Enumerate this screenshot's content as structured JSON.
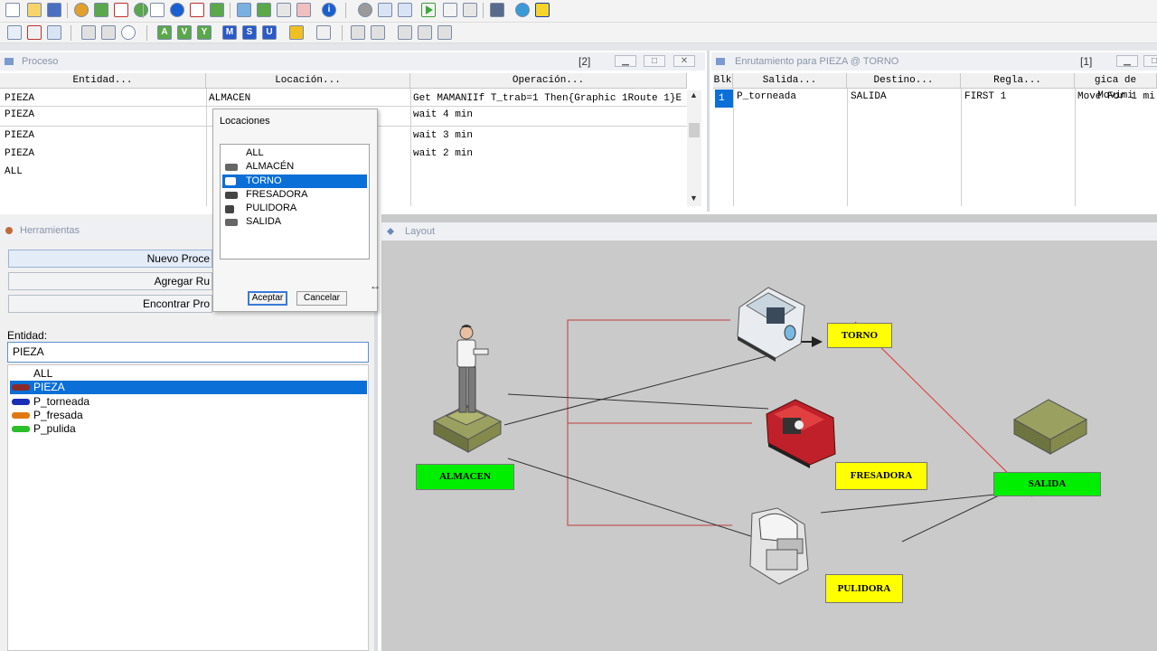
{
  "toolbar1": {
    "icons": [
      "new-icon",
      "open-icon",
      "save-icon",
      "palette-icon",
      "layers-icon",
      "route-icon",
      "person-icon",
      "rectangle-icon",
      "circle-icon",
      "arrow-icon",
      "grid-icon",
      "image-icon",
      "text-icon",
      "info-icon",
      "settings-icon",
      "window-icon",
      "export-icon",
      "play-icon",
      "step-icon",
      "stop-icon",
      "table-icon",
      "globe-icon",
      "flag-icon"
    ]
  },
  "toolbar2": {
    "letters": [
      "A",
      "V",
      "Y",
      "M",
      "S",
      "U"
    ]
  },
  "proceso": {
    "title": "Proceso",
    "count": "[2]",
    "columns": [
      "Entidad...",
      "Locación...",
      "Operación..."
    ],
    "rows": [
      {
        "entidad": "PIEZA",
        "locacion": "ALMACÉN",
        "operacion": "Get MAMANIIf T_trab=1 Then{Graphic 1Route 1}E"
      },
      {
        "entidad": "PIEZA",
        "locacion": "",
        "operacion": "wait 4 min"
      },
      {
        "entidad": "PIEZA",
        "locacion": "",
        "operacion": "wait 3 min"
      },
      {
        "entidad": "PIEZA",
        "locacion": "",
        "operacion": "wait 2 min"
      },
      {
        "entidad": "ALL",
        "locacion": "",
        "operacion": ""
      }
    ]
  },
  "enrutamiento": {
    "title": "Enrutamiento para PIEZA @ TORNO",
    "count": "[1]",
    "columns": [
      "Blk",
      "Salida...",
      "Destino...",
      "Regla...",
      "gica de Movimi"
    ],
    "row": {
      "blk": "1",
      "salida": "P_torneada",
      "destino": "SALIDA",
      "regla": "FIRST 1",
      "logica": "Move For 1 mi"
    }
  },
  "herramientas": {
    "title": "Herramientas",
    "buttons": [
      "Nuevo Proce",
      "Agregar Ru",
      "Encontrar Pro"
    ],
    "entidad_label": "Entidad:",
    "entidad_value": "PIEZA",
    "entities": [
      {
        "name": "ALL",
        "icon": "",
        "color": ""
      },
      {
        "name": "PIEZA",
        "icon": "piece-icon",
        "color": "#8b2a2a"
      },
      {
        "name": "P_torneada",
        "icon": "piece-icon",
        "color": "#1a2fb5"
      },
      {
        "name": "P_fresada",
        "icon": "piece-icon",
        "color": "#e07a10"
      },
      {
        "name": "P_pulida",
        "icon": "piece-icon",
        "color": "#2bbf2b"
      }
    ]
  },
  "dialog": {
    "title": "Locaciones",
    "items": [
      "ALL",
      "ALMACÉN",
      "TORNO",
      "FRESADORA",
      "PULIDORA",
      "SALIDA"
    ],
    "selected": "TORNO",
    "accept": "Aceptar",
    "cancel": "Cancelar"
  },
  "layout": {
    "title": "Layout",
    "labels": {
      "torno": "TORNO",
      "almacen": "ALMACEN",
      "fresadora": "FRESADORA",
      "salida": "SALIDA",
      "pulidora": "PULIDORA"
    },
    "colors": {
      "yellow": "#ffff00",
      "green": "#00ee00",
      "background": "#cacaca",
      "selection": "#0a6fd6"
    }
  }
}
